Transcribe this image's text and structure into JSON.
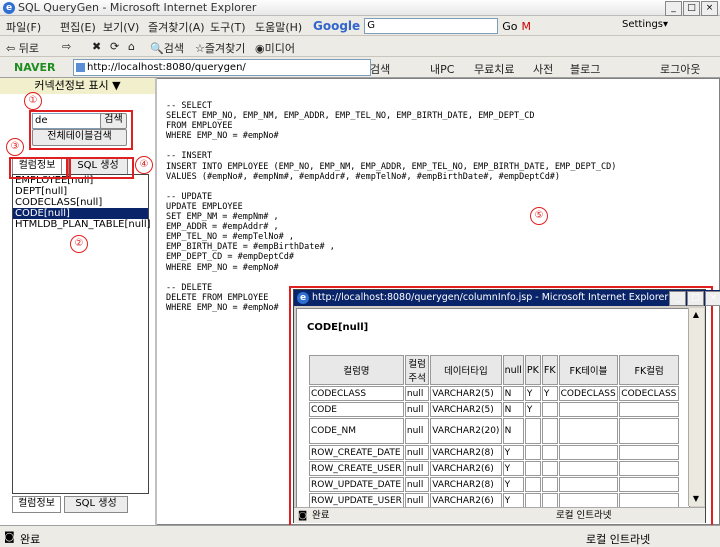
{
  "window": {
    "title": "SQL QueryGen - Microsoft Internet Explorer"
  },
  "menu": [
    "파일(F)",
    "편집(E)",
    "보기(V)",
    "즐겨찾기(A)",
    "도구(T)",
    "도움말(H)"
  ],
  "google_toolbar": {
    "logo": "Google",
    "go": "Go",
    "settings": "Settings▾",
    "search_value": "G"
  },
  "toolbar": {
    "back": "뒤로",
    "search": "검색",
    "favorites": "즐겨찾기",
    "media": "미디어"
  },
  "naver_bar": {
    "brand": "NAVER",
    "url": "http://localhost:8080/querygen/",
    "search": "검색",
    "my_pc": "내PC",
    "free_cure": "무료치료",
    "dictionary": "사전",
    "blog": "블로그",
    "logout": "로그아웃"
  },
  "left_panel": {
    "header": "커넥션정보 표시 ▼",
    "search_value": "de",
    "search_button": "검색",
    "all_tables_button": "전체테이블검색",
    "tab_column_info": "컬럼정보",
    "tab_sql_gen": "SQL 생성",
    "tables": [
      "EMPLOYEE[null]",
      "DEPT[null]",
      "CODECLASS[null]",
      "CODE[null]",
      "HTMLDB_PLAN_TABLE[null]"
    ],
    "selected_index": 3,
    "bottom_tab_column_info": "컬럼정보",
    "bottom_tab_sql_gen": "SQL 생성"
  },
  "annotations": [
    "①",
    "②",
    "③",
    "④",
    "⑤"
  ],
  "sql_text": "-- SELECT\nSELECT EMP_NO, EMP_NM, EMP_ADDR, EMP_TEL_NO, EMP_BIRTH_DATE, EMP_DEPT_CD\nFROM EMPLOYEE\nWHERE EMP_NO = #empNo#\n\n-- INSERT\nINSERT INTO EMPLOYEE (EMP_NO, EMP_NM, EMP_ADDR, EMP_TEL_NO, EMP_BIRTH_DATE, EMP_DEPT_CD)\nVALUES (#empNo#, #empNm#, #empAddr#, #empTelNo#, #empBirthDate#, #empDeptCd#)\n\n-- UPDATE\nUPDATE EMPLOYEE\nSET EMP_NM = #empNm# ,\nEMP_ADDR = #empAddr# ,\nEMP_TEL_NO = #empTelNo# ,\nEMP_BIRTH_DATE = #empBirthDate# ,\nEMP_DEPT_CD = #empDeptCd#\nWHERE EMP_NO = #empNo#\n\n-- DELETE\nDELETE FROM EMPLOYEE\nWHERE EMP_NO = #empNo#",
  "popup": {
    "title": "http://localhost:8080/querygen/columnInfo.jsp - Microsoft Internet Explorer",
    "heading": "CODE[null]",
    "columns": [
      "컬럼명",
      "컬럼주석",
      "데이터타입",
      "null",
      "PK",
      "FK",
      "FK테이블",
      "FK컬럼"
    ],
    "rows": [
      [
        "CODECLASS",
        "null",
        "VARCHAR2(5)",
        "N",
        "Y",
        "Y",
        "CODECLASS",
        "CODECLASS"
      ],
      [
        "CODE",
        "null",
        "VARCHAR2(5)",
        "N",
        "Y",
        "",
        "",
        ""
      ],
      [
        "CODE_NM",
        "null",
        "VARCHAR2(20)",
        "N",
        "",
        "",
        "",
        ""
      ],
      [
        "ROW_CREATE_DATE",
        "null",
        "VARCHAR2(8)",
        "Y",
        "",
        "",
        "",
        ""
      ],
      [
        "ROW_CREATE_USER",
        "null",
        "VARCHAR2(6)",
        "Y",
        "",
        "",
        "",
        ""
      ],
      [
        "ROW_UPDATE_DATE",
        "null",
        "VARCHAR2(8)",
        "Y",
        "",
        "",
        "",
        ""
      ],
      [
        "ROW_UPDATE_USER",
        "null",
        "VARCHAR2(6)",
        "Y",
        "",
        "",
        "",
        ""
      ]
    ],
    "status_left": "완료",
    "status_zone": "로컬 인트라넷"
  },
  "status": {
    "left": "완료",
    "zone": "로컬 인트라넷"
  },
  "colors": {
    "highlight": "#e02020",
    "selection": "#0a246a"
  }
}
